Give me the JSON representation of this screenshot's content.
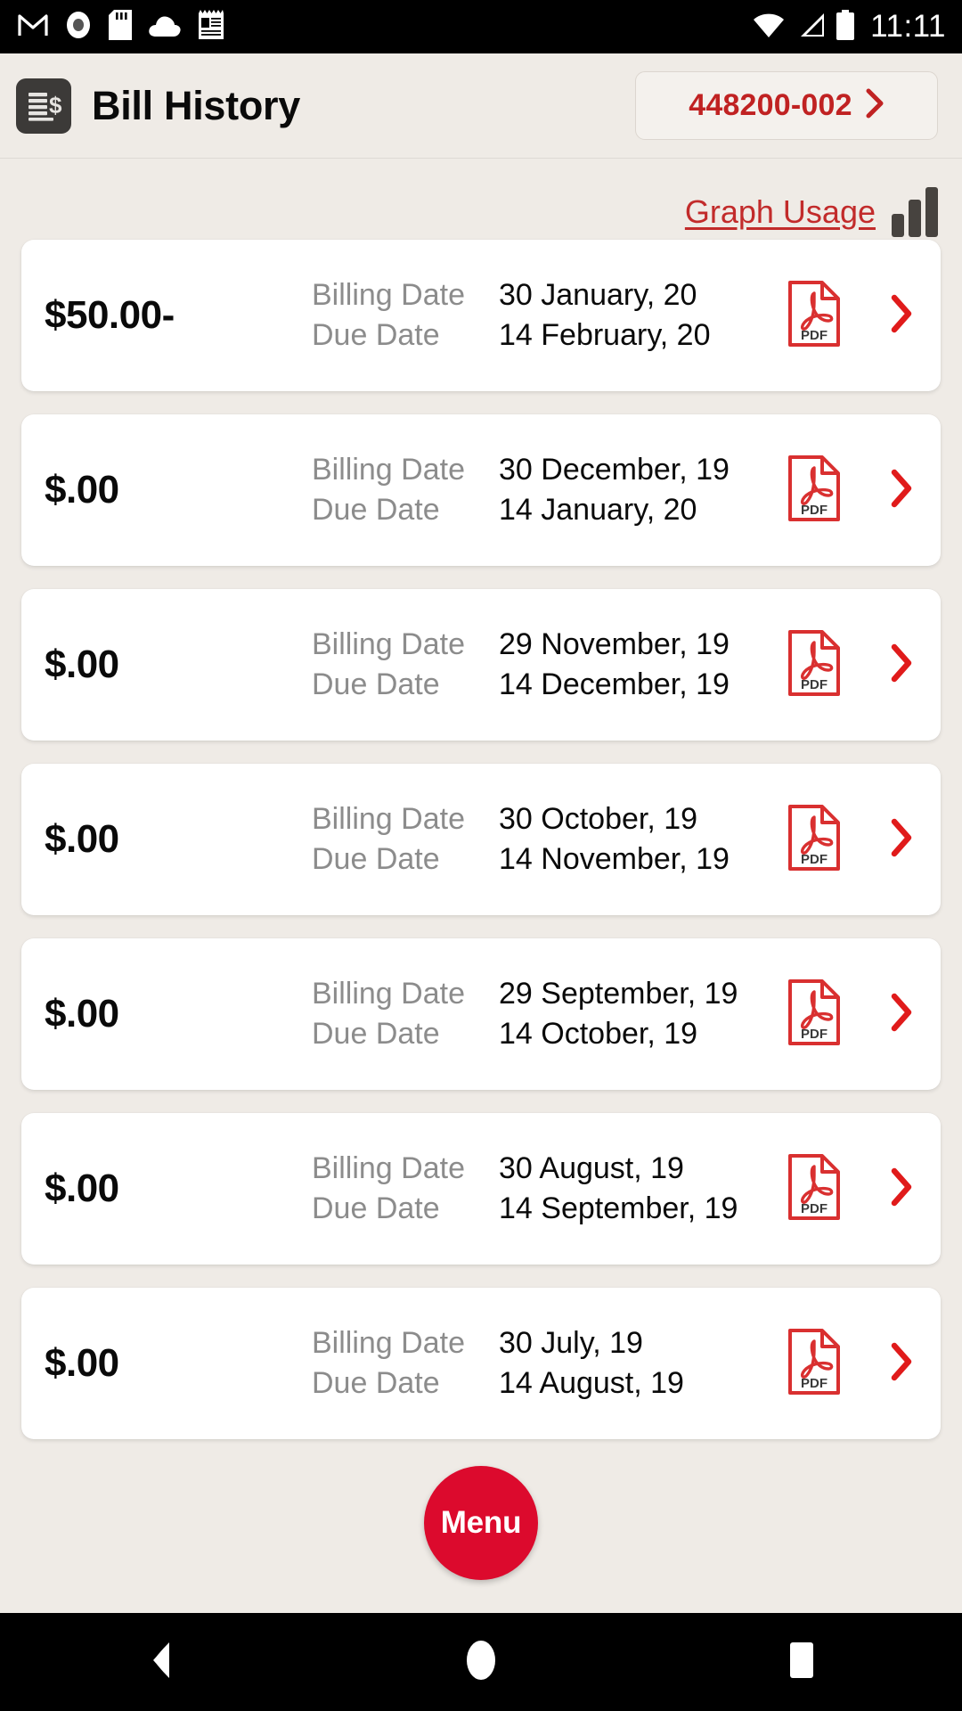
{
  "status_bar": {
    "time": "11:11",
    "left_icons": [
      "gmail-icon",
      "record-icon",
      "sd-card-icon",
      "cloud-icon",
      "notepad-icon"
    ],
    "right_icons": [
      "wifi-icon",
      "cell-signal-icon",
      "battery-icon"
    ]
  },
  "header": {
    "icon": "bill-document-icon",
    "title": "Bill History",
    "account": {
      "number": "448200-002",
      "chevron": "chevron-right-icon"
    }
  },
  "toolbar": {
    "graph_usage_label": "Graph Usage",
    "graph_icon": "bar-chart-icon"
  },
  "labels": {
    "billing_date": "Billing Date",
    "due_date": "Due Date",
    "pdf_icon": "pdf-file-icon",
    "row_chevron": "chevron-right-icon"
  },
  "bills": [
    {
      "amount": "$50.00-",
      "billing_date": "30 January, 20",
      "due_date": "14 February, 20"
    },
    {
      "amount": "$.00",
      "billing_date": "30 December, 19",
      "due_date": "14 January, 20"
    },
    {
      "amount": "$.00",
      "billing_date": "29 November, 19",
      "due_date": "14 December, 19"
    },
    {
      "amount": "$.00",
      "billing_date": "30 October, 19",
      "due_date": "14 November, 19"
    },
    {
      "amount": "$.00",
      "billing_date": "29 September, 19",
      "due_date": "14 October, 19"
    },
    {
      "amount": "$.00",
      "billing_date": "30 August, 19",
      "due_date": "14 September, 19"
    },
    {
      "amount": "$.00",
      "billing_date": "30 July, 19",
      "due_date": "14 August, 19"
    }
  ],
  "fab": {
    "label": "Menu"
  },
  "nav_bar": {
    "back": "back-triangle-icon",
    "home": "home-circle-icon",
    "recents": "recents-square-icon"
  },
  "colors": {
    "accent_red": "#C02222",
    "fab_red": "#DC0A2D",
    "page_background": "#EFEBE6",
    "card_background": "#FFFFFF",
    "label_gray": "#8C8C8C",
    "icon_dark": "#3C3A38"
  }
}
